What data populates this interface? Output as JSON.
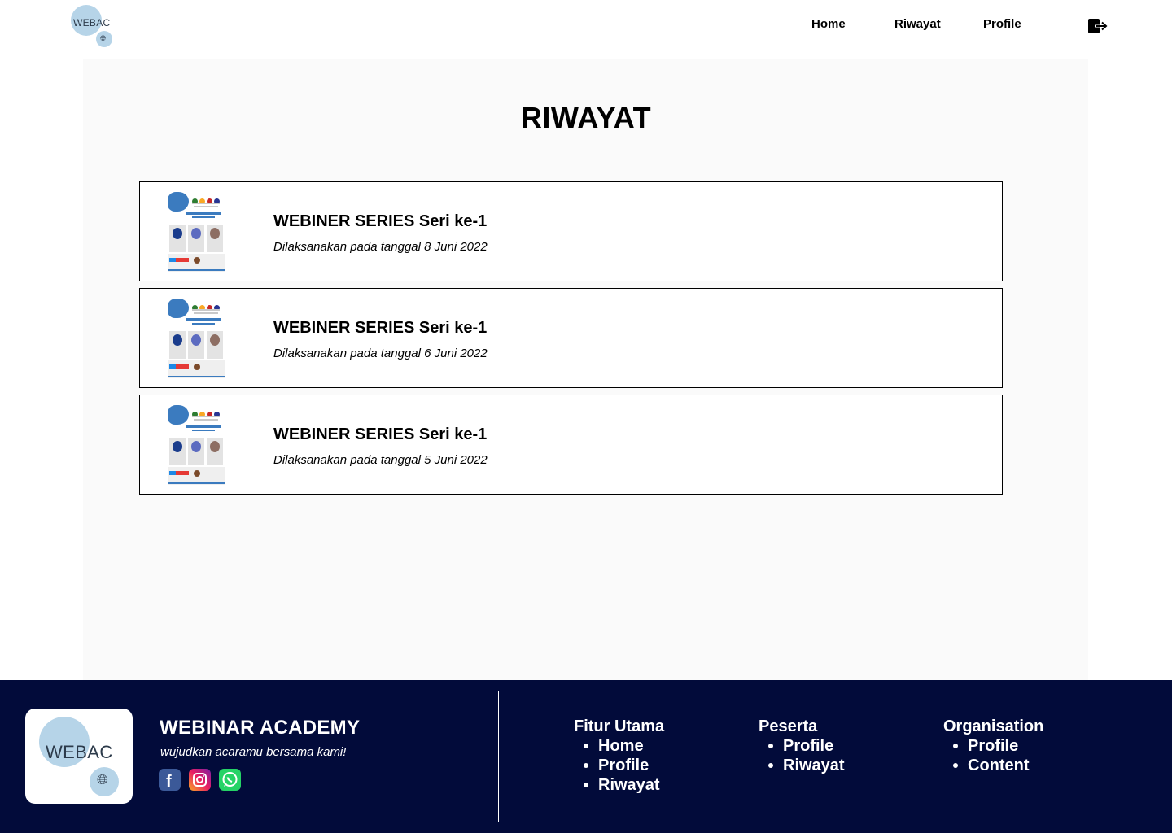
{
  "header": {
    "logo_text": "WEBAC",
    "nav": [
      {
        "label": "Home"
      },
      {
        "label": "Riwayat"
      },
      {
        "label": "Profile"
      }
    ],
    "logout_icon": "logout-icon"
  },
  "main": {
    "title": "RIWAYAT",
    "items": [
      {
        "title": "WEBINER SERIES Seri ke-1",
        "date": "Dilaksanakan pada tanggal 8 Juni 2022"
      },
      {
        "title": "WEBINER SERIES Seri ke-1",
        "date": "Dilaksanakan pada tanggal 6 Juni 2022"
      },
      {
        "title": "WEBINER SERIES Seri ke-1",
        "date": "Dilaksanakan pada tanggal 5 Juni 2022"
      }
    ]
  },
  "footer": {
    "logo_text": "WEBAC",
    "brand_name": "WEBINAR ACADEMY",
    "tagline": "wujudkan acaramu bersama kami!",
    "socials": [
      "facebook-icon",
      "instagram-icon",
      "whatsapp-icon"
    ],
    "columns": [
      {
        "heading": "Fitur Utama",
        "links": [
          "Home",
          "Profile",
          "Riwayat"
        ]
      },
      {
        "heading": "Peserta",
        "links": [
          "Profile",
          "Riwayat"
        ]
      },
      {
        "heading": "Organisation",
        "links": [
          "Profile",
          "Content"
        ]
      }
    ]
  },
  "colors": {
    "footer_bg": "#020b3a",
    "panel_bg": "#fafafa",
    "logo_blob": "#b6d4e8",
    "facebook": "#3b5998",
    "whatsapp": "#25d366"
  }
}
